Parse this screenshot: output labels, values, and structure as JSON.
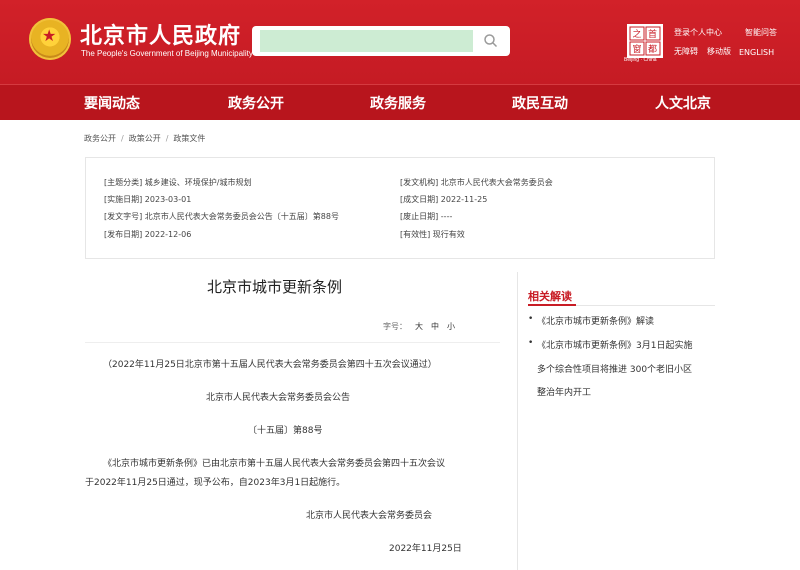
{
  "header": {
    "site_title": "北京市人民政府",
    "site_subtitle": "The People's Government of Beijing Municipality",
    "search_placeholder": "",
    "capital_logo_text": "首都之窗",
    "capital_sub": "Beijing · China",
    "links": {
      "login": "登录个人中心",
      "smart_qa": "智能问答",
      "accessible": "无障碍",
      "mobile": "移动版",
      "english": "ENGLISH"
    }
  },
  "nav": {
    "items": [
      "要闻动态",
      "政务公开",
      "政务服务",
      "政民互动",
      "人文北京"
    ]
  },
  "breadcrumb": [
    "政务公开",
    "政策公开",
    "政策文件"
  ],
  "meta": {
    "subject_label": "[主题分类]",
    "subject_value": "城乡建设、环境保护/城市规划",
    "issuer_label": "[发文机构]",
    "issuer_value": "北京市人民代表大会常务委员会",
    "effective_label": "[实施日期]",
    "effective_value": "2023-03-01",
    "written_label": "[成文日期]",
    "written_value": "2022-11-25",
    "docno_label": "[发文字号]",
    "docno_value": "北京市人民代表大会常务委员会公告〔十五届〕第88号",
    "abolish_label": "[废止日期]",
    "abolish_value": "----",
    "publish_label": "[发布日期]",
    "publish_value": "2022-12-06",
    "validity_label": "[有效性]",
    "validity_value": "现行有效"
  },
  "article": {
    "title": "北京市城市更新条例",
    "font_size_label": "字号：",
    "font_large": "大",
    "font_medium": "中",
    "font_small": "小",
    "passed_note": "（2022年11月25日北京市第十五届人民代表大会常务委员会第四十五次会议通过）",
    "issuer_line": "北京市人民代表大会常务委员会公告",
    "number_line": "〔十五届〕第88号",
    "para1_line1": "《北京市城市更新条例》已由北京市第十五届人民代表大会常务委员会第四十五次会议",
    "para1_line2": "于2022年11月25日通过，现予公布，自2023年3月1日起施行。",
    "signature": "北京市人民代表大会常务委员会",
    "date": "2022年11月25日"
  },
  "related": {
    "title": "相关解读",
    "items": [
      {
        "line1": "《北京市城市更新条例》解读"
      },
      {
        "line1": "《北京市城市更新条例》3月1日起实施",
        "line2": "多个综合性项目将推进 300个老旧小区",
        "line3": "整治年内开工"
      }
    ]
  },
  "colors": {
    "brand_red": "#c81c25",
    "nav_red": "#b8151d",
    "search_fill": "#cdecd3"
  }
}
